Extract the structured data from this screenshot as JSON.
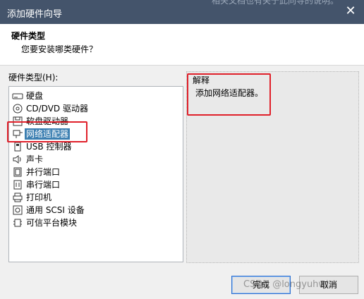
{
  "window": {
    "title": "添加硬件向导",
    "bg_fragment": "相关文档也有关于此向导的说明。"
  },
  "header": {
    "title": "硬件类型",
    "subtitle": "您要安装哪类硬件？"
  },
  "list": {
    "label": "硬件类型(H):",
    "items": [
      {
        "label": "硬盘",
        "icon": "hard-disk"
      },
      {
        "label": "CD/DVD 驱动器",
        "icon": "cd-dvd"
      },
      {
        "label": "软盘驱动器",
        "icon": "floppy"
      },
      {
        "label": "网络适配器",
        "icon": "network",
        "selected": true
      },
      {
        "label": "USB 控制器",
        "icon": "usb"
      },
      {
        "label": "声卡",
        "icon": "speaker"
      },
      {
        "label": "并行端口",
        "icon": "parallel-port"
      },
      {
        "label": "串行端口",
        "icon": "serial-port"
      },
      {
        "label": "打印机",
        "icon": "printer"
      },
      {
        "label": "通用 SCSI 设备",
        "icon": "scsi"
      },
      {
        "label": "可信平台模块",
        "icon": "tpm"
      }
    ]
  },
  "info": {
    "caption": "解释",
    "description": "添加网络适配器。"
  },
  "buttons": {
    "finish": "完成",
    "cancel": "取消"
  },
  "watermark": "CSDN @longyuhwlz",
  "colors": {
    "titlebar": "#44546b",
    "selection": "#3c7fb1",
    "highlight": "#e0202a"
  }
}
